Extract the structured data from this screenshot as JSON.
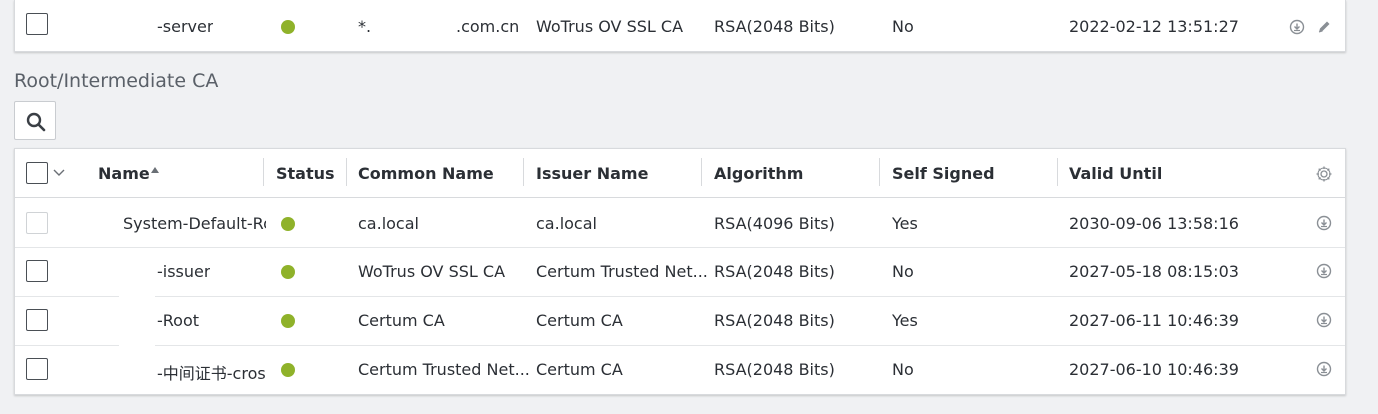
{
  "top_row": {
    "name": "-server",
    "common_name_prefix": "*.s",
    "common_name_suffix": ".com.cn",
    "issuer": "WoTrus OV SSL CA",
    "algorithm": "RSA(2048 Bits)",
    "self_signed": "No",
    "valid_until": "2022-02-12 13:51:27"
  },
  "section": {
    "title": "Root/Intermediate CA"
  },
  "table": {
    "headers": {
      "name": "Name",
      "status": "Status",
      "common_name": "Common Name",
      "issuer_name": "Issuer Name",
      "algorithm": "Algorithm",
      "self_signed": "Self Signed",
      "valid_until": "Valid Until"
    },
    "rows": [
      {
        "name": "System-Default-Roc",
        "common_name": "ca.local",
        "issuer": "ca.local",
        "algorithm": "RSA(4096 Bits)",
        "self_signed": "Yes",
        "valid_until": "2030-09-06 13:58:16"
      },
      {
        "name": "-issuer",
        "common_name": "WoTrus OV SSL CA",
        "issuer": "Certum Trusted Net...",
        "algorithm": "RSA(2048 Bits)",
        "self_signed": "No",
        "valid_until": "2027-05-18 08:15:03"
      },
      {
        "name": "-Root",
        "common_name": "Certum CA",
        "issuer": "Certum CA",
        "algorithm": "RSA(2048 Bits)",
        "self_signed": "Yes",
        "valid_until": "2027-06-11 10:46:39"
      },
      {
        "name": "-中间证书-cros",
        "common_name": "Certum Trusted Net...",
        "issuer": "Certum CA",
        "algorithm": "RSA(2048 Bits)",
        "self_signed": "No",
        "valid_until": "2027-06-10 10:46:39"
      }
    ]
  },
  "colors": {
    "status_ok": "#8fb22a",
    "icon": "#8a8f95"
  },
  "icons": {
    "download": "download-circle-icon",
    "edit": "pencil-icon",
    "search": "magnifier-icon",
    "settings": "gear-icon",
    "sort": "sort-asc-icon",
    "chevron": "chevron-down-icon"
  }
}
